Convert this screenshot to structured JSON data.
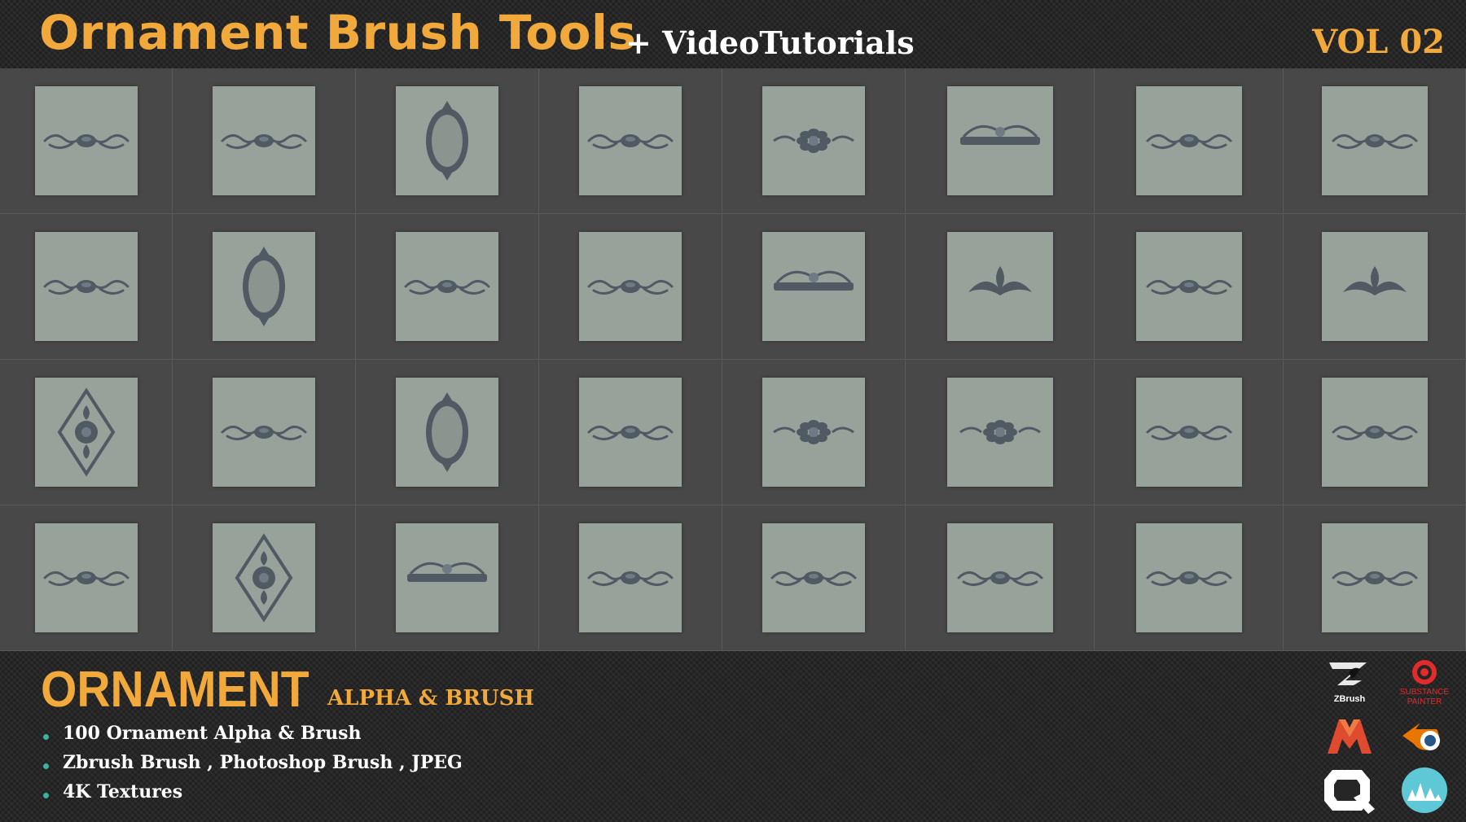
{
  "header": {
    "title": "Ornament Brush Tools",
    "subtitle": "+ VideoTutorials",
    "volume": "VOL 02"
  },
  "grid": {
    "rows": 4,
    "columns": 8,
    "tile_color": "#97a29b",
    "ornament_color": "#4f5a63"
  },
  "footer": {
    "heading": "ORNAMENT",
    "subheading": "ALPHA & BRUSH",
    "features": [
      "100 Ornament Alpha & Brush",
      "Zbrush Brush , Photoshop Brush , JPEG",
      "4K Textures"
    ]
  },
  "software_logos": {
    "zbrush": "ZBrush",
    "substance_line1": "SUBSTANCE",
    "substance_line2": "PAINTER",
    "items": [
      {
        "name": "zbrush-logo-icon"
      },
      {
        "name": "substance-painter-logo-icon"
      },
      {
        "name": "3ds-max-logo-icon"
      },
      {
        "name": "blender-logo-icon"
      },
      {
        "name": "quixel-logo-icon"
      },
      {
        "name": "unknown-wave-logo-icon"
      }
    ]
  },
  "colors": {
    "accent": "#f2a93b",
    "bullet": "#37b3a0",
    "text": "#ffffff"
  }
}
